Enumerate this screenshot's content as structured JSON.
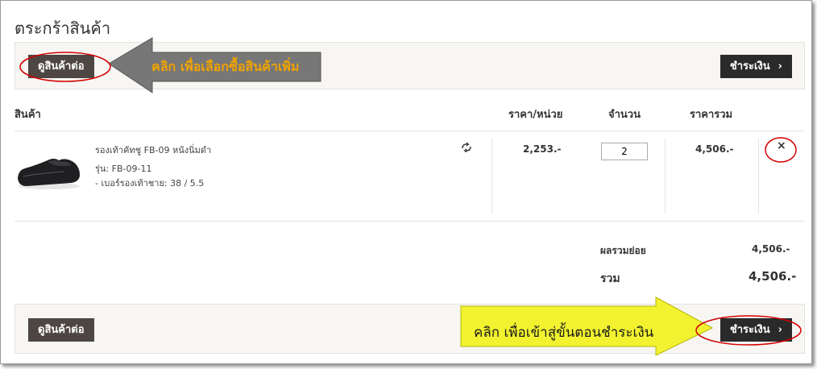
{
  "page": {
    "title": "ตระกร้าสินค้า"
  },
  "top_bar": {
    "continue_label": "ดูสินค้าต่อ",
    "checkout_label": "ชำระเงิน",
    "callout_text": "คลิก เพื่อเลือกซื้อสินค้าเพิ่ม"
  },
  "table": {
    "headers": {
      "product": "สินค้า",
      "unit_price": "ราคา/หน่วย",
      "quantity": "จำนวน",
      "total": "ราคารวม"
    }
  },
  "item": {
    "name": "รองเท้าคัทชู FB-09 หนังนิ่มดำ",
    "model": "รุ่น: FB-09-11",
    "size": "- เบอร์รองเท้าชาย: 38 / 5.5",
    "unit_price": "2,253.-",
    "quantity": "2",
    "total": "4,506.-"
  },
  "summary": {
    "subtotal_label": "ผลรวมย่อย",
    "subtotal_value": "4,506.-",
    "total_label": "รวม",
    "total_value": "4,506.-"
  },
  "bottom_bar": {
    "continue_label": "ดูสินค้าต่อ",
    "checkout_label": "ชำระเงิน",
    "callout_text": "คลิก เพื่อเข้าสู่ขั้นตอนชำระเงิน"
  },
  "colors": {
    "dark_button": "#2a2a2a",
    "brown_button": "#4d4643",
    "annotation_red": "#d40000",
    "gray_arrow": "#777777",
    "yellow_arrow": "#f2f230",
    "callout_orange": "#f0a300"
  },
  "icons": {
    "arrow_right": "chevron-right-icon",
    "remove": "close-icon",
    "refresh": "refresh-icon"
  }
}
